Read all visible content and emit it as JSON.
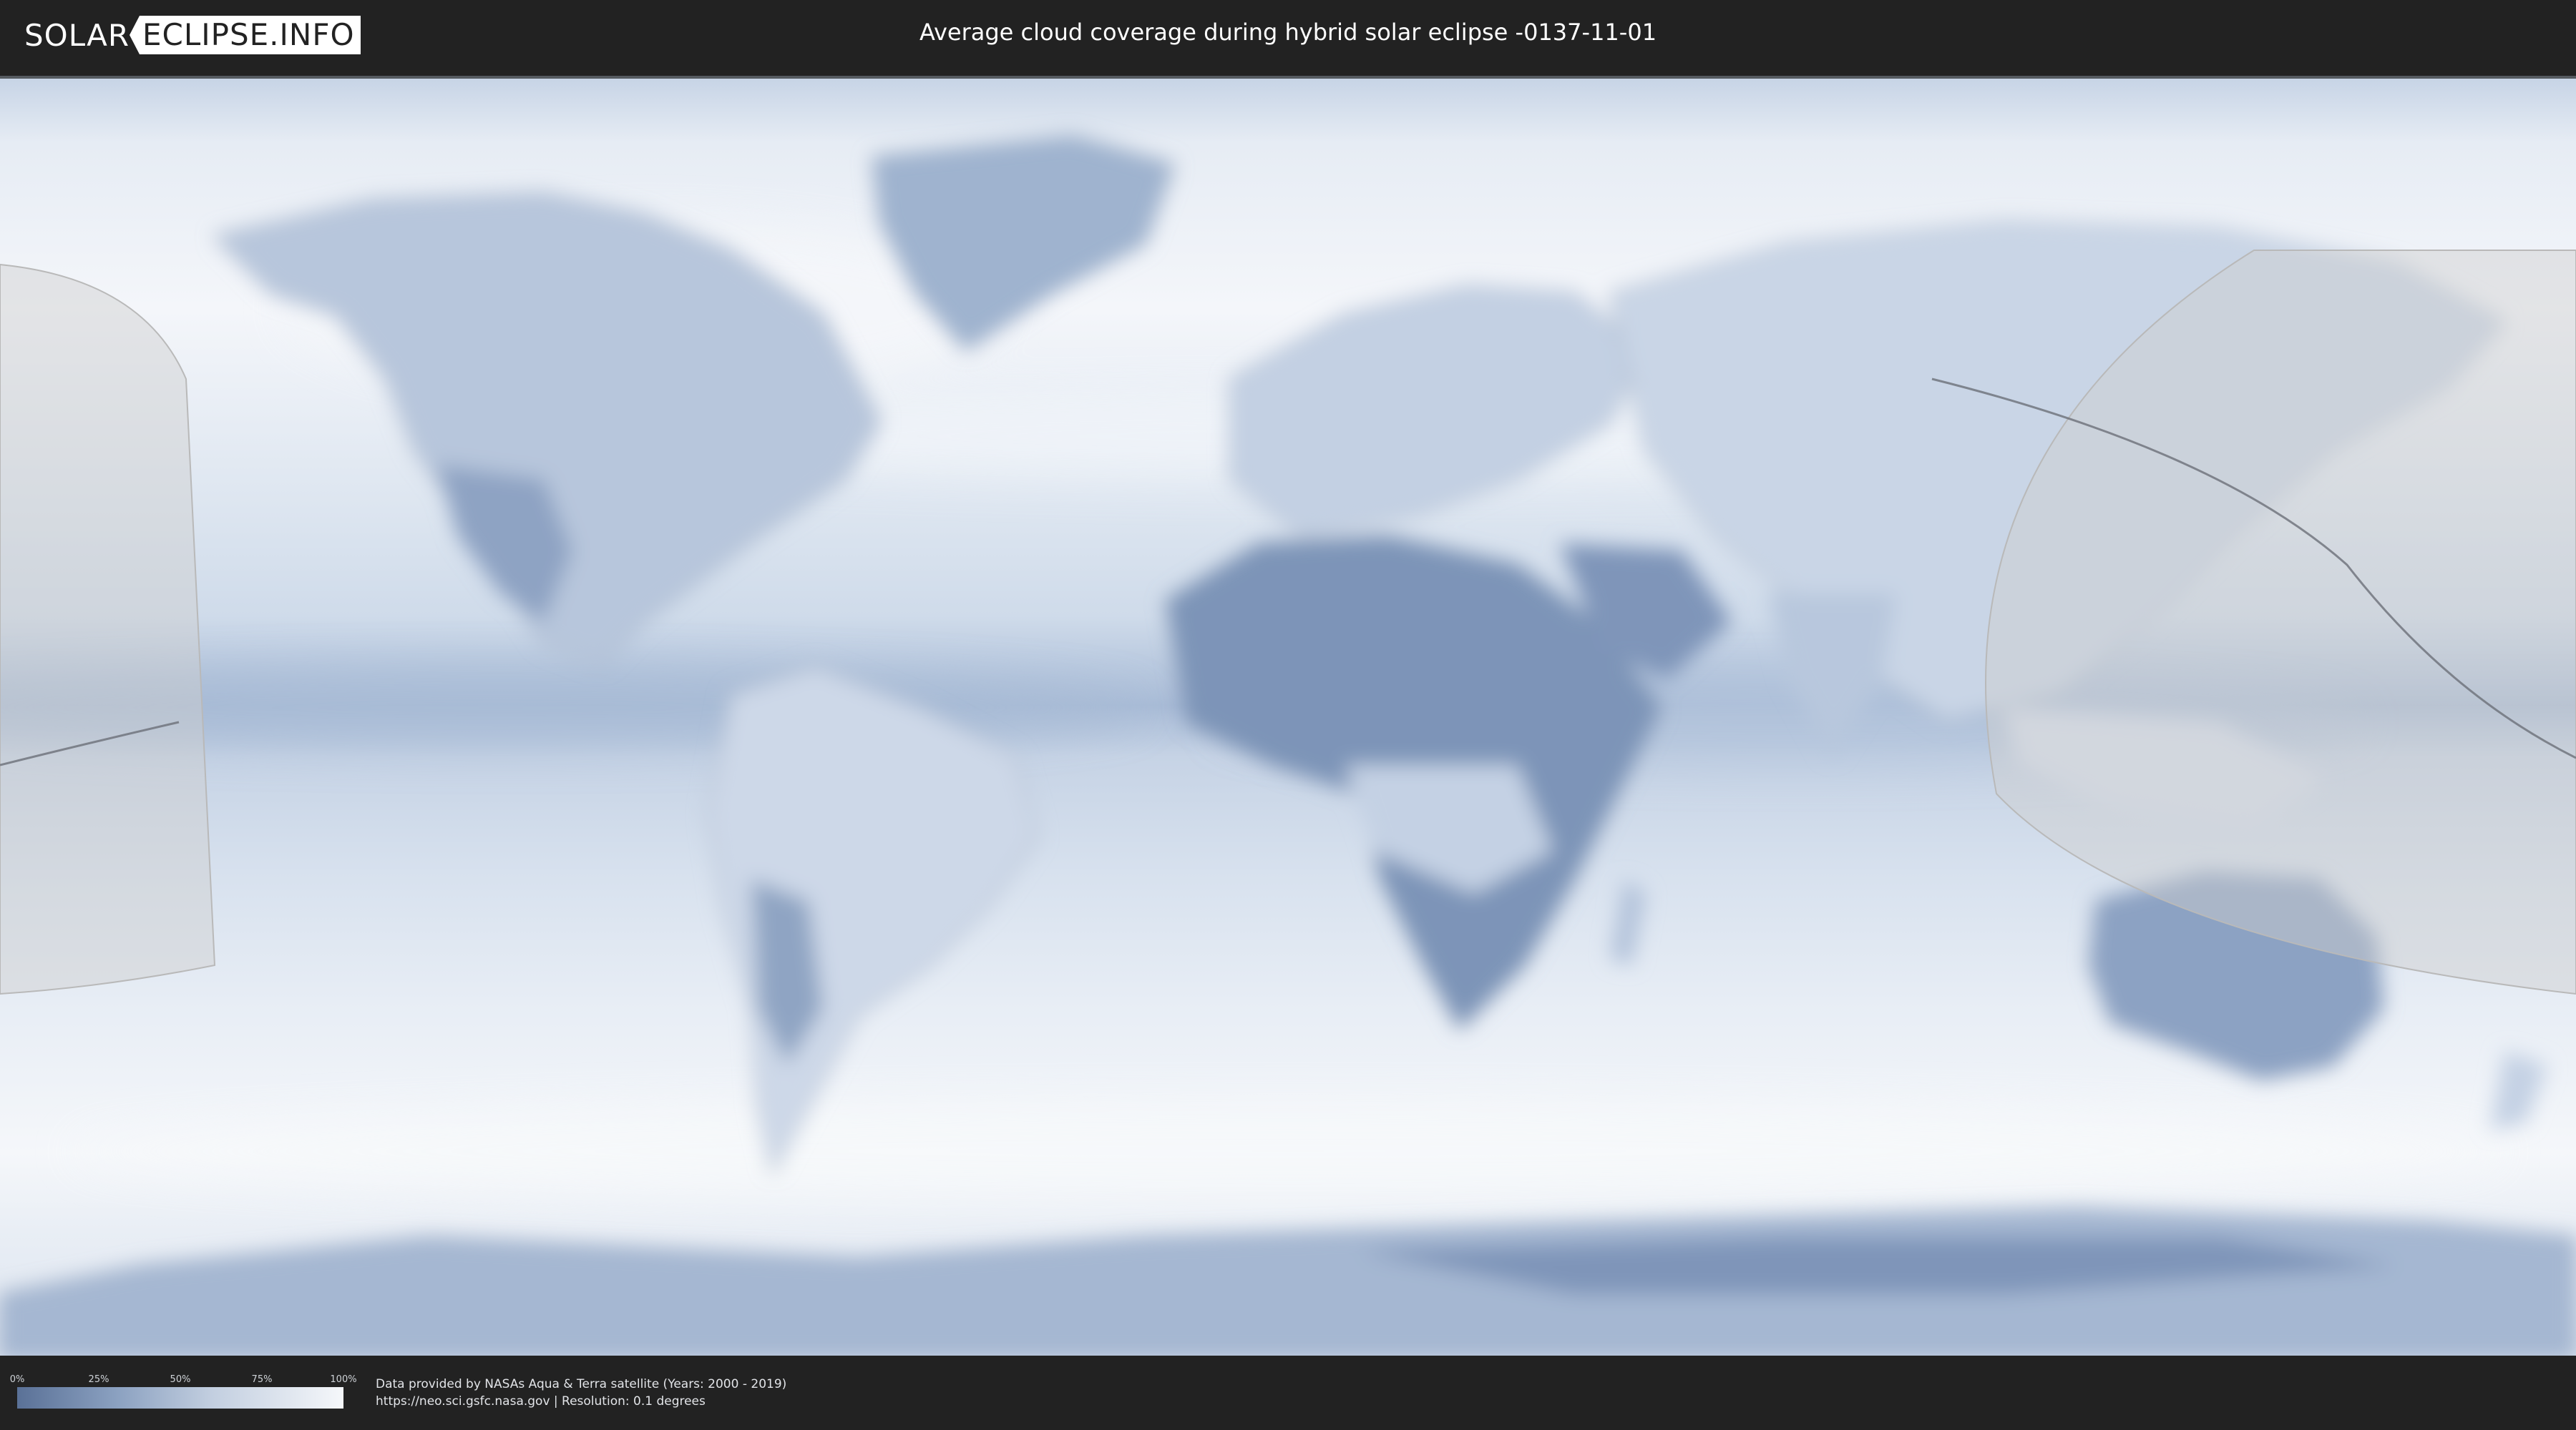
{
  "header": {
    "logo_left": "SOLAR",
    "logo_right": "ECLIPSE.INFO",
    "title": "Average cloud coverage during hybrid solar eclipse -0137-11-01"
  },
  "map": {
    "kind": "world-cloud-coverage-map",
    "projection": "equirectangular",
    "colors": {
      "clear": "#5a7197",
      "cloudy": "#f5f7fa",
      "ocean_mid": "#b9c8dd",
      "land_border": "#7f8ea6",
      "penumbra_shade": "#d8d8d8",
      "eclipse_path": "#6b6f78"
    }
  },
  "legend": {
    "scale_labels": [
      "0%",
      "25%",
      "50%",
      "75%",
      "100%"
    ],
    "scale_values": [
      0,
      25,
      50,
      75,
      100
    ],
    "gradient_from": "#5a7197",
    "gradient_to": "#f5f7fa"
  },
  "footer": {
    "credit_line1": "Data provided by NASAs Aqua & Terra satellite (Years: 2000 - 2019)",
    "credit_line2": "https://neo.sci.gsfc.nasa.gov | Resolution: 0.1 degrees"
  }
}
